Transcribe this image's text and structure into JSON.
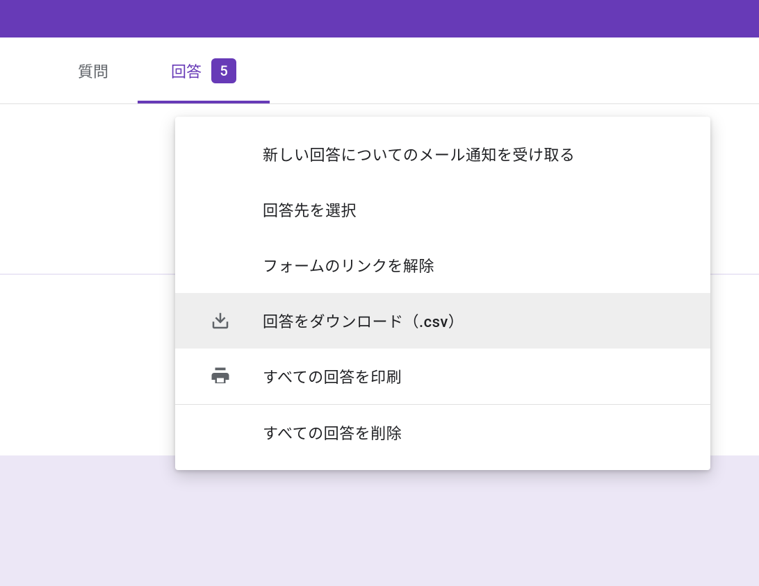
{
  "colors": {
    "primary": "#673ab7",
    "background": "#ece7f6",
    "surface": "#ffffff",
    "text_muted": "#5f6368",
    "text": "#202124",
    "divider": "#e0e0e0",
    "hover": "#eeeeee"
  },
  "tabs": {
    "questions": {
      "label": "質問"
    },
    "responses": {
      "label": "回答",
      "badge": "5",
      "active": true
    }
  },
  "menu": {
    "items": [
      {
        "id": "email_notify",
        "label": "新しい回答についてのメール通知を受け取る",
        "icon": null
      },
      {
        "id": "select_destination",
        "label": "回答先を選択",
        "icon": null
      },
      {
        "id": "unlink_form",
        "label": "フォームのリンクを解除",
        "icon": null
      },
      {
        "id": "download_csv",
        "label": "回答をダウンロード（.csv）",
        "icon": "download",
        "highlighted": true
      },
      {
        "id": "print_all",
        "label": "すべての回答を印刷",
        "icon": "print"
      },
      {
        "id": "delete_all",
        "label": "すべての回答を削除",
        "icon": null
      }
    ]
  }
}
